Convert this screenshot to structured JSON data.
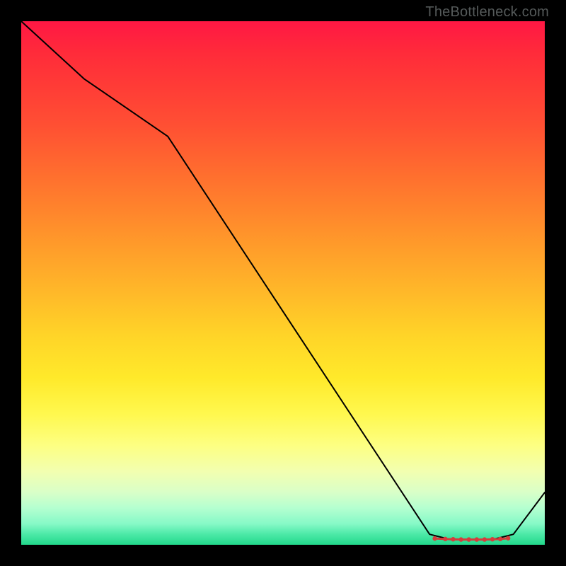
{
  "watermark": "TheBottleneck.com",
  "chart_data": {
    "type": "line",
    "title": "",
    "xlabel": "",
    "ylabel": "",
    "xlim": [
      0,
      100
    ],
    "ylim": [
      0,
      100
    ],
    "x": [
      0,
      12,
      28,
      78,
      82,
      86,
      90,
      94,
      100
    ],
    "values": [
      100,
      89,
      78,
      2,
      1,
      1,
      1,
      2,
      10
    ],
    "markers": {
      "style": "dots",
      "color": "#d63c3c",
      "x": [
        79,
        81,
        82.5,
        84,
        85.5,
        87,
        88.5,
        90,
        91.5,
        93
      ],
      "y": [
        1.2,
        1.1,
        1.05,
        1.0,
        1.0,
        1.0,
        1.0,
        1.05,
        1.1,
        1.25
      ]
    },
    "line_color": "#000000",
    "line_width": 2
  },
  "colors": {
    "background": "#000000",
    "gradient_top": "#ff1744",
    "gradient_bottom": "#22d88b",
    "line": "#000000",
    "marker": "#d63c3c",
    "watermark": "#555a5a"
  }
}
